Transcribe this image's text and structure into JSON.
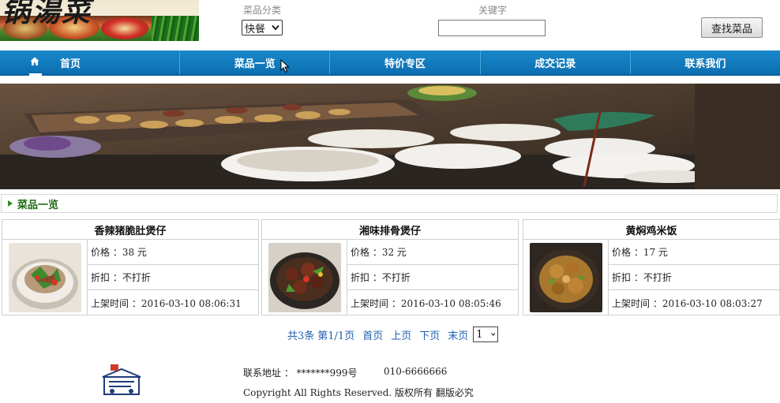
{
  "header": {
    "logo_text": "锅湯菜",
    "category_label": "菜品分类",
    "category_value": "快餐",
    "keyword_label": "关键字",
    "keyword_value": "",
    "search_button": "查找菜品"
  },
  "nav": {
    "items": [
      {
        "label": "首页",
        "icon": "home-icon"
      },
      {
        "label": "菜品一览"
      },
      {
        "label": "特价专区"
      },
      {
        "label": "成交记录"
      },
      {
        "label": "联系我们"
      }
    ]
  },
  "section": {
    "title": "菜品一览"
  },
  "dishes": [
    {
      "name": "香辣猪脆肚煲仔",
      "price": "价格 ：38 元",
      "discount": "折扣 ：不打折",
      "listed": "上架时间 ：2016-03-10 08:06:31"
    },
    {
      "name": "湘味排骨煲仔",
      "price": "价格 ：32 元",
      "discount": "折扣 ：不打折",
      "listed": "上架时间 ：2016-03-10 08:05:46"
    },
    {
      "name": "黄焖鸡米饭",
      "price": "价格 ：17 元",
      "discount": "折扣 ：不打折",
      "listed": "上架时间 ：2016-03-10 08:03:27"
    }
  ],
  "pagination": {
    "total": "共3条",
    "page_info": "第1/1页",
    "first": "首页",
    "prev": "上页",
    "next": "下页",
    "last": "末页",
    "page_select": "1"
  },
  "footer": {
    "address": "联系地址 ： *******999号",
    "phone": "010-6666666",
    "copyright": "Copyright All Rights Reserved. 版权所有  翻版必究"
  },
  "colors": {
    "nav_blue": "#0b6fb0",
    "section_green": "#1e6b14",
    "link_blue": "#1f5fb0"
  }
}
